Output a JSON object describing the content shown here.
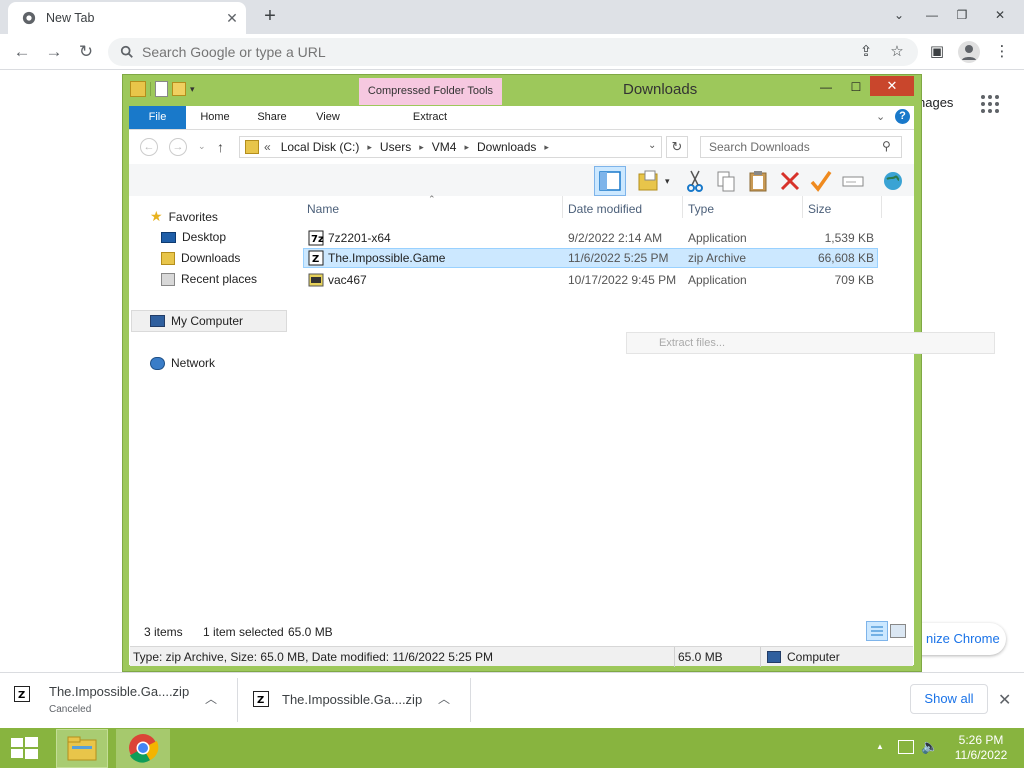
{
  "chrome": {
    "tab_title": "New Tab",
    "omnibox_placeholder": "Search Google or type a URL",
    "ntp_images_link": "nages",
    "customize_label": "nize Chrome"
  },
  "explorer": {
    "title": "Downloads",
    "context_tab": "Compressed Folder Tools",
    "ribbon_tabs": [
      "File",
      "Home",
      "Share",
      "View",
      "Extract"
    ],
    "breadcrumb": {
      "overflow": "«",
      "parts": [
        "Local Disk (C:)",
        "Users",
        "VM4",
        "Downloads"
      ]
    },
    "search_placeholder": "Search Downloads",
    "nav": {
      "favorites": "Favorites",
      "desktop": "Desktop",
      "downloads": "Downloads",
      "recent": "Recent places",
      "mycomputer": "My Computer",
      "network": "Network"
    },
    "columns": {
      "name": "Name",
      "date": "Date modified",
      "type": "Type",
      "size": "Size"
    },
    "files": [
      {
        "name": "7z2201-x64",
        "date": "9/2/2022 2:14 AM",
        "type": "Application",
        "size": "1,539 KB"
      },
      {
        "name": "The.Impossible.Game",
        "date": "11/6/2022 5:25 PM",
        "type": "zip Archive",
        "size": "66,608 KB"
      },
      {
        "name": "vac467",
        "date": "10/17/2022 9:45 PM",
        "type": "Application",
        "size": "709 KB"
      }
    ],
    "extract_hint": "Extract files...",
    "status": {
      "items": "3 items",
      "selected": "1 item selected",
      "selected_size": "65.0 MB",
      "details": "Type: zip Archive, Size: 65.0 MB, Date modified: 11/6/2022 5:25 PM",
      "details_size": "65.0 MB",
      "location": "Computer"
    }
  },
  "downloads_shelf": {
    "item1_name": "The.Impossible.Ga....zip",
    "item1_status": "Canceled",
    "item2_name": "The.Impossible.Ga....zip",
    "show_all": "Show all"
  },
  "taskbar": {
    "time": "5:26 PM",
    "date": "11/6/2022"
  }
}
